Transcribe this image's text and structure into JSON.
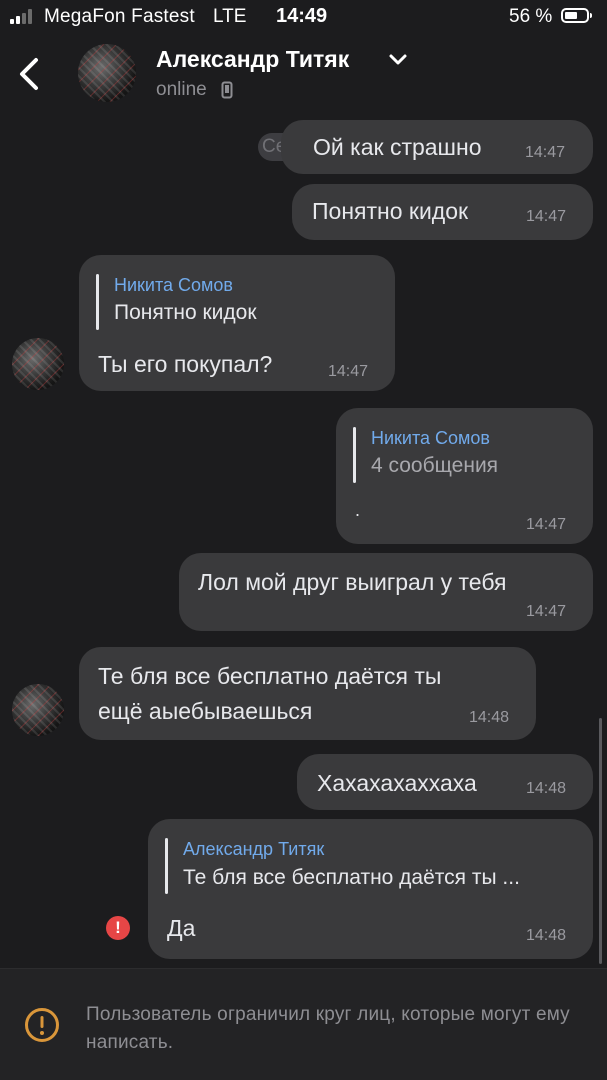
{
  "status_bar": {
    "carrier": "MegaFon Fastest",
    "network": "LTE",
    "time": "14:49",
    "battery": "56 %"
  },
  "header": {
    "name": "Александр Титяк",
    "status": "online"
  },
  "date_separator": "Сегодня",
  "messages": [
    {
      "side": "out",
      "text": "Ой как страшно",
      "time": "14:47"
    },
    {
      "side": "out",
      "text": "Понятно кидок",
      "time": "14:47"
    },
    {
      "side": "in",
      "reply": {
        "author": "Никита Сомов",
        "text": "Понятно кидок"
      },
      "text": "Ты его покупал?",
      "time": "14:47"
    },
    {
      "side": "out",
      "reply": {
        "author": "Никита Сомов",
        "text": "4 сообщения"
      },
      "text": ".",
      "time": "14:47"
    },
    {
      "side": "out",
      "text": "Лол мой друг выиграл у тебя",
      "time": "14:47"
    },
    {
      "side": "in",
      "text_lines": [
        "Те бля все бесплатно даётся ты",
        "ещё аыебываешься"
      ],
      "time": "14:48"
    },
    {
      "side": "out",
      "text": "Хахахахаххаха",
      "time": "14:48"
    },
    {
      "side": "out",
      "reply": {
        "author": "Александр Титяк",
        "text": "Те бля все бесплатно даётся ты ..."
      },
      "text": "Да",
      "time": "14:48",
      "failed": true
    }
  ],
  "error_icon_label": "!",
  "footer": {
    "text": "Пользователь ограничил круг лиц, которые могут ему написать."
  },
  "colors": {
    "background": "#1c1c1e",
    "bubble": "#3a3a3c",
    "reply_author": "#71aaeb",
    "error": "#e64646",
    "warning": "#d9963a"
  },
  "icons": [
    "back-icon",
    "chevron-down-icon",
    "phone-icon",
    "error-icon",
    "warning-icon"
  ]
}
